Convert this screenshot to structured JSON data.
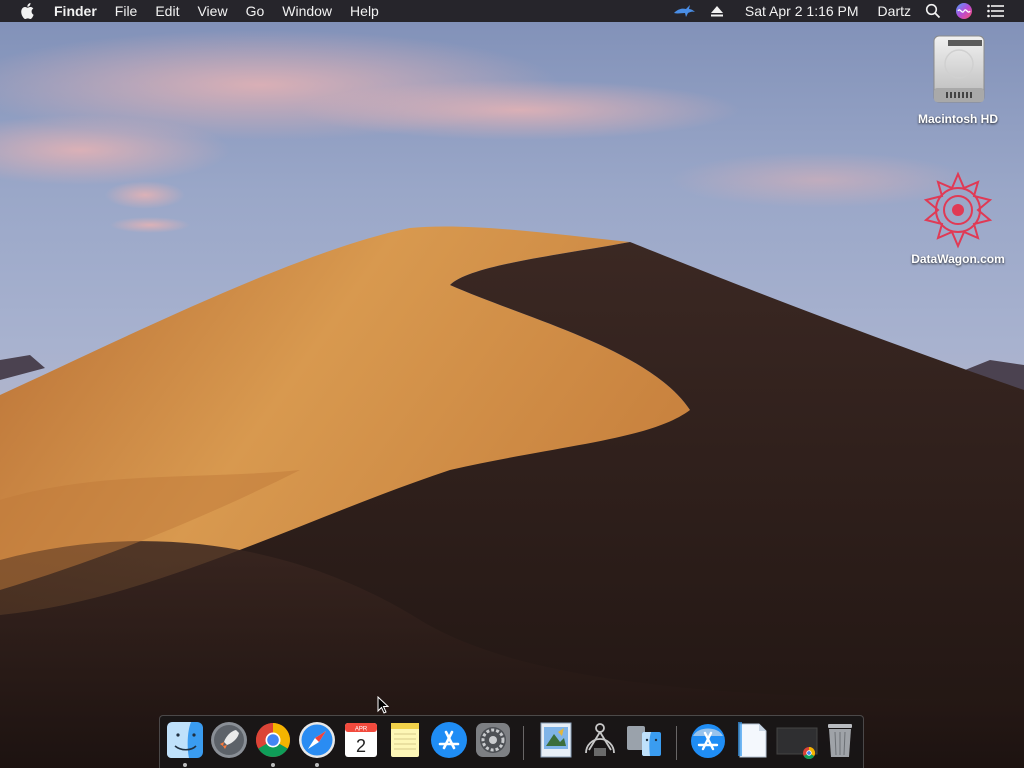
{
  "menubar": {
    "app_name": "Finder",
    "menus": [
      "File",
      "Edit",
      "View",
      "Go",
      "Window",
      "Help"
    ],
    "clock": "Sat Apr 2  1:16 PM",
    "user": "Dartz",
    "icons": [
      "apple-icon",
      "bird-icon",
      "eject-icon",
      "spotlight-search-icon",
      "siri-icon",
      "notification-center-icon"
    ]
  },
  "desktop": {
    "icons": [
      {
        "label": "Macintosh HD",
        "icon": "hard-drive-icon"
      },
      {
        "label": "DataWagon.com",
        "icon": "datawagon-logo-icon"
      }
    ]
  },
  "dock": {
    "calendar_month": "APR",
    "calendar_day": "2",
    "items": [
      "finder-icon",
      "launchpad-icon",
      "chrome-icon",
      "safari-icon",
      "calendar-icon",
      "notes-icon",
      "app-store-icon",
      "system-preferences-icon",
      "preview-icon",
      "directory-utility-icon",
      "migration-assistant-icon",
      "app-store-folder-icon",
      "documents-stack-icon",
      "chrome-window-icon",
      "trash-icon"
    ]
  },
  "colors": {
    "sky_top": "#8fa3c6",
    "dune_light": "#d9964a",
    "dune_shadow": "#2b1c17",
    "menubar_bg": "#1e1c1e"
  }
}
